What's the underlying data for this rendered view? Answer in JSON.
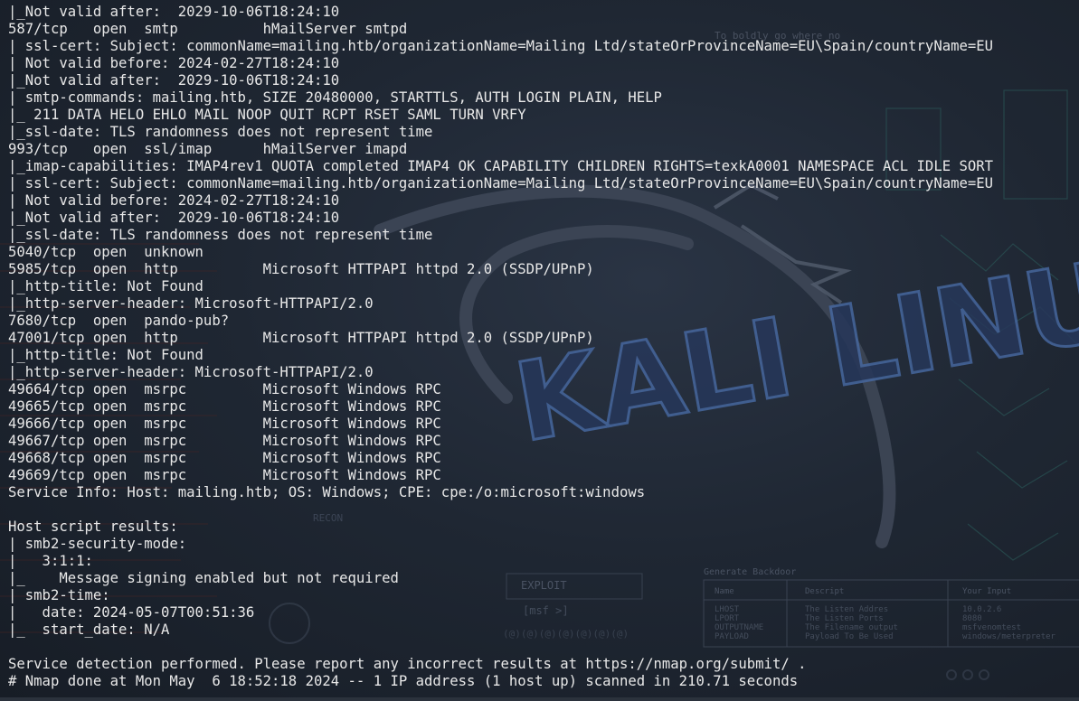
{
  "wallpaper": {
    "logo_text": "KALI LINUX",
    "slogan": "To boldly go where no",
    "labels": {
      "recon": "RECON",
      "exploit": "EXPLOIT",
      "msf_prompt": "[msf >]",
      "generate_backdoor": "Generate Backdoor"
    },
    "backdoor_table": {
      "headers": [
        "Name",
        "Descript",
        "Your Input"
      ],
      "rows": [
        [
          "LHOST",
          "The Listen Addres",
          "10.0.2.6"
        ],
        [
          "LPORT",
          "The Listen Ports",
          "8080"
        ],
        [
          "OUTPUTNAME",
          "The Filename output",
          "msfvenomtest"
        ],
        [
          "PAYLOAD",
          "Payload To Be Used",
          "windows/meterpreter"
        ]
      ]
    },
    "colors": {
      "background": "#1c2531",
      "logo_fill": "#2a3f63",
      "logo_stroke": "#3f5e92",
      "dragon": "#3a4352",
      "accent_red": "#6b1e1e",
      "accent_teal": "#2f6b66"
    }
  },
  "terminal": {
    "text_color": "#e8e8e8",
    "lines": [
      "|_Not valid after:  2029-10-06T18:24:10",
      "587/tcp   open  smtp          hMailServer smtpd",
      "| ssl-cert: Subject: commonName=mailing.htb/organizationName=Mailing Ltd/stateOrProvinceName=EU\\Spain/countryName=EU",
      "| Not valid before: 2024-02-27T18:24:10",
      "|_Not valid after:  2029-10-06T18:24:10",
      "| smtp-commands: mailing.htb, SIZE 20480000, STARTTLS, AUTH LOGIN PLAIN, HELP",
      "|_ 211 DATA HELO EHLO MAIL NOOP QUIT RCPT RSET SAML TURN VRFY",
      "|_ssl-date: TLS randomness does not represent time",
      "993/tcp   open  ssl/imap      hMailServer imapd",
      "|_imap-capabilities: IMAP4rev1 QUOTA completed IMAP4 OK CAPABILITY CHILDREN RIGHTS=texkA0001 NAMESPACE ACL IDLE SORT",
      "| ssl-cert: Subject: commonName=mailing.htb/organizationName=Mailing Ltd/stateOrProvinceName=EU\\Spain/countryName=EU",
      "| Not valid before: 2024-02-27T18:24:10",
      "|_Not valid after:  2029-10-06T18:24:10",
      "|_ssl-date: TLS randomness does not represent time",
      "5040/tcp  open  unknown",
      "5985/tcp  open  http          Microsoft HTTPAPI httpd 2.0 (SSDP/UPnP)",
      "|_http-title: Not Found",
      "|_http-server-header: Microsoft-HTTPAPI/2.0",
      "7680/tcp  open  pando-pub?",
      "47001/tcp open  http          Microsoft HTTPAPI httpd 2.0 (SSDP/UPnP)",
      "|_http-title: Not Found",
      "|_http-server-header: Microsoft-HTTPAPI/2.0",
      "49664/tcp open  msrpc         Microsoft Windows RPC",
      "49665/tcp open  msrpc         Microsoft Windows RPC",
      "49666/tcp open  msrpc         Microsoft Windows RPC",
      "49667/tcp open  msrpc         Microsoft Windows RPC",
      "49668/tcp open  msrpc         Microsoft Windows RPC",
      "49669/tcp open  msrpc         Microsoft Windows RPC",
      "Service Info: Host: mailing.htb; OS: Windows; CPE: cpe:/o:microsoft:windows",
      "",
      "Host script results:",
      "| smb2-security-mode:",
      "|   3:1:1:",
      "|_    Message signing enabled but not required",
      "| smb2-time:",
      "|   date: 2024-05-07T00:51:36",
      "|_  start_date: N/A",
      "",
      "Service detection performed. Please report any incorrect results at https://nmap.org/submit/ .",
      "# Nmap done at Mon May  6 18:52:18 2024 -- 1 IP address (1 host up) scanned in 210.71 seconds"
    ]
  }
}
